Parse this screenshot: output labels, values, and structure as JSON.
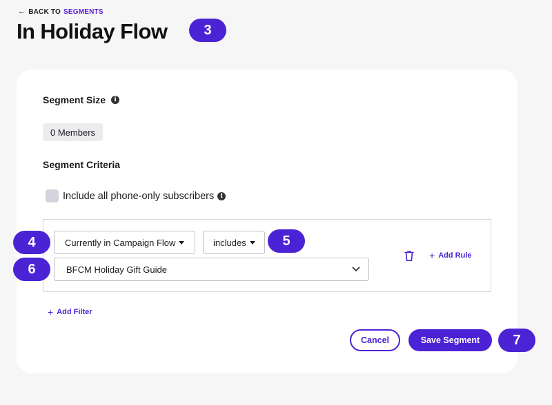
{
  "header": {
    "back_prefix": "Back to",
    "back_link": "Segments",
    "title": "In Holiday Flow"
  },
  "segment_size": {
    "label": "Segment Size",
    "members": "0 Members"
  },
  "criteria": {
    "label": "Segment Criteria",
    "include_phone_only_label": "Include all phone-only subscribers",
    "include_phone_only_checked": false
  },
  "filter": {
    "condition_select": "Currently in Campaign Flow",
    "operator_select": "includes",
    "value_select": "BFCM Holiday Gift Guide",
    "add_rule_label": "Add Rule"
  },
  "add_filter_label": "Add Filter",
  "actions": {
    "cancel_label": "Cancel",
    "save_label": "Save Segment"
  },
  "callouts": [
    "3",
    "4",
    "5",
    "6",
    "7"
  ],
  "colors": {
    "accent": "#4b22d4",
    "page_bg": "#f6f6f6",
    "card_bg": "#ffffff"
  },
  "icons": {
    "back": "arrow-left-icon",
    "info": "info-icon",
    "trash": "trash-icon",
    "plus": "plus-icon",
    "chevron": "chevron-down-icon"
  }
}
